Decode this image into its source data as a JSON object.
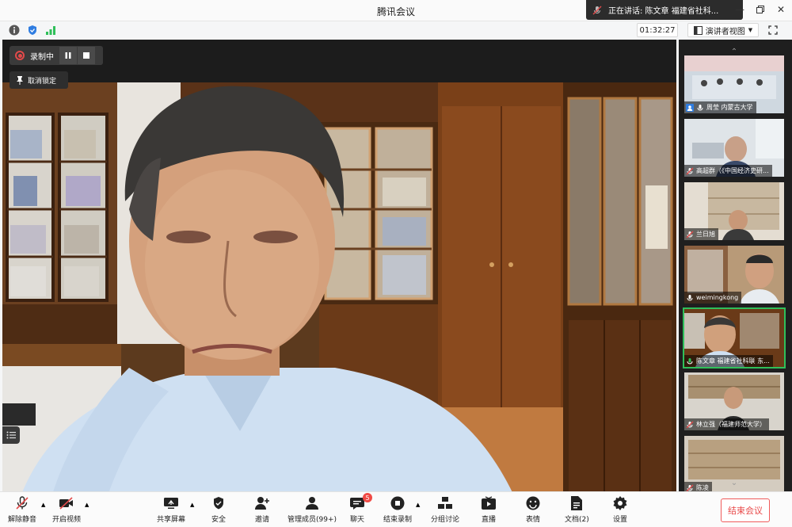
{
  "window": {
    "title": "腾讯会议"
  },
  "speaking": {
    "text": "正在讲话: 陈文章  福建省社科..."
  },
  "infobar": {
    "timer": "01:32:27",
    "view_label": "演讲者视图"
  },
  "recording": {
    "label": "录制中"
  },
  "pin": {
    "unpin_label": "取消锁定"
  },
  "participants": [
    {
      "name": "周莹  内蒙古大学",
      "mic": "on"
    },
    {
      "name": "高超群（《中国经济史研...",
      "mic": "muted"
    },
    {
      "name": "兰日旭",
      "mic": "muted"
    },
    {
      "name": "weimingkong",
      "mic": "on"
    },
    {
      "name": "陈文章  福建省社科联 东...",
      "mic": "on",
      "active": true
    },
    {
      "name": "林立强（福建师范大学）",
      "mic": "muted"
    },
    {
      "name": "陈凌",
      "mic": "muted"
    }
  ],
  "toolbar": {
    "unmute": "解除静音",
    "start_video": "开启视频",
    "share_screen": "共享屏幕",
    "security": "安全",
    "invite": "邀请",
    "manage_members": "管理成员(99+)",
    "chat": "聊天",
    "chat_badge": "5",
    "end_record": "结束录制",
    "breakout": "分组讨论",
    "live": "直播",
    "reactions": "表情",
    "docs": "文档(2)",
    "settings": "设置",
    "end_meeting": "结束会议"
  },
  "colors": {
    "accent_red": "#e94a4a",
    "active_green": "#2fbf5a",
    "dark_bg": "#1f1f1f"
  }
}
